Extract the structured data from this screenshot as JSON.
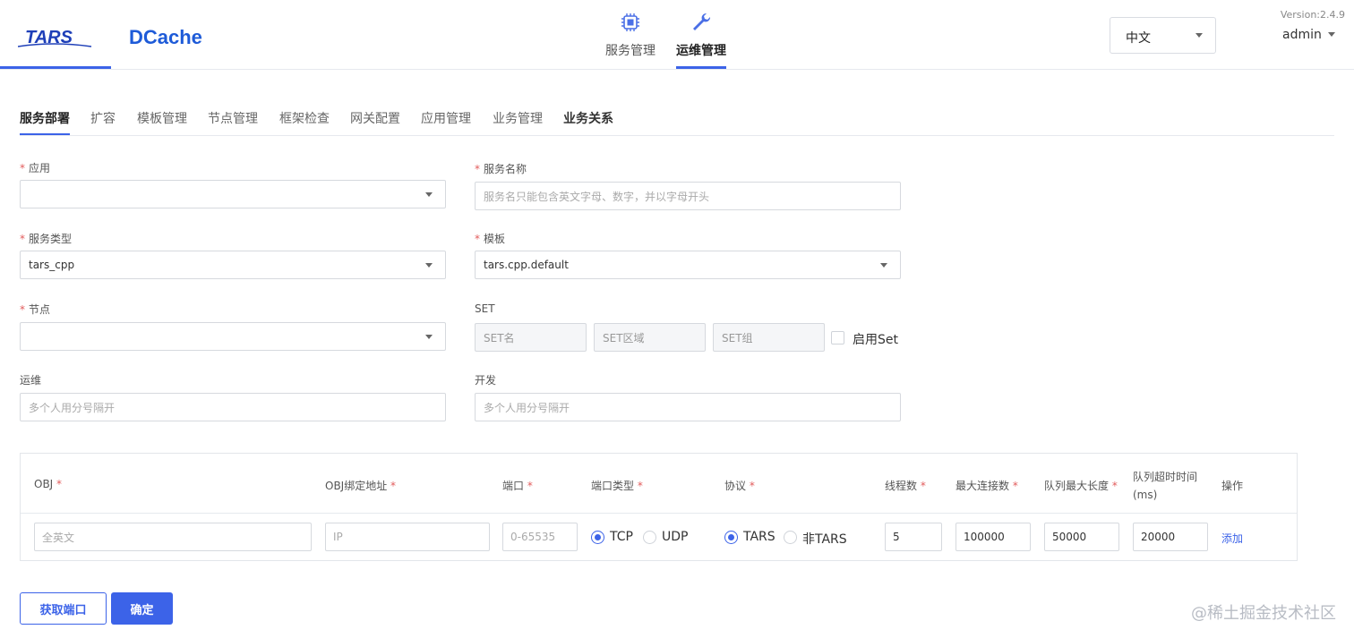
{
  "header": {
    "logo_tars": "TARS",
    "logo_dcache": "DCache",
    "nav": [
      {
        "label": "服务管理",
        "icon": "chip-icon"
      },
      {
        "label": "运维管理",
        "icon": "wrench-icon"
      }
    ],
    "language": "中文",
    "version": "Version:2.4.9",
    "user": "admin",
    "accent": "#3c63e8"
  },
  "tabs": [
    "服务部署",
    "扩容",
    "模板管理",
    "节点管理",
    "框架检查",
    "网关配置",
    "应用管理",
    "业务管理",
    "业务关系"
  ],
  "form": {
    "app": {
      "label": "应用",
      "value": ""
    },
    "server_name": {
      "label": "服务名称",
      "placeholder": "服务名只能包含英文字母、数字，并以字母开头"
    },
    "server_type": {
      "label": "服务类型",
      "value": "tars_cpp"
    },
    "template": {
      "label": "模板",
      "value": "tars.cpp.default"
    },
    "node": {
      "label": "节点",
      "value": ""
    },
    "set": {
      "label": "SET",
      "name_placeholder": "SET名",
      "area_placeholder": "SET区域",
      "group_placeholder": "SET组",
      "enable_label": "启用Set"
    },
    "ops": {
      "label": "运维",
      "placeholder": "多个人用分号隔开"
    },
    "dev": {
      "label": "开发",
      "placeholder": "多个人用分号隔开"
    }
  },
  "table": {
    "headers": {
      "obj": "OBJ",
      "bind": "OBJ绑定地址",
      "port": "端口",
      "port_type": "端口类型",
      "protocol": "协议",
      "threads": "线程数",
      "max_conn": "最大连接数",
      "queue_max": "队列最大长度",
      "queue_timeout_1": "队列超时时间",
      "queue_timeout_2": "(ms)",
      "ops": "操作"
    },
    "row": {
      "obj_placeholder": "全英文",
      "bind_placeholder": "IP",
      "port_placeholder": "0-65535",
      "tcp": "TCP",
      "udp": "UDP",
      "tars": "TARS",
      "non_tars": "非TARS",
      "threads": "5",
      "max_conn": "100000",
      "queue_max": "50000",
      "queue_timeout": "20000",
      "add": "添加"
    }
  },
  "buttons": {
    "get_port": "获取端口",
    "confirm": "确定"
  },
  "watermark": "@稀土掘金技术社区"
}
